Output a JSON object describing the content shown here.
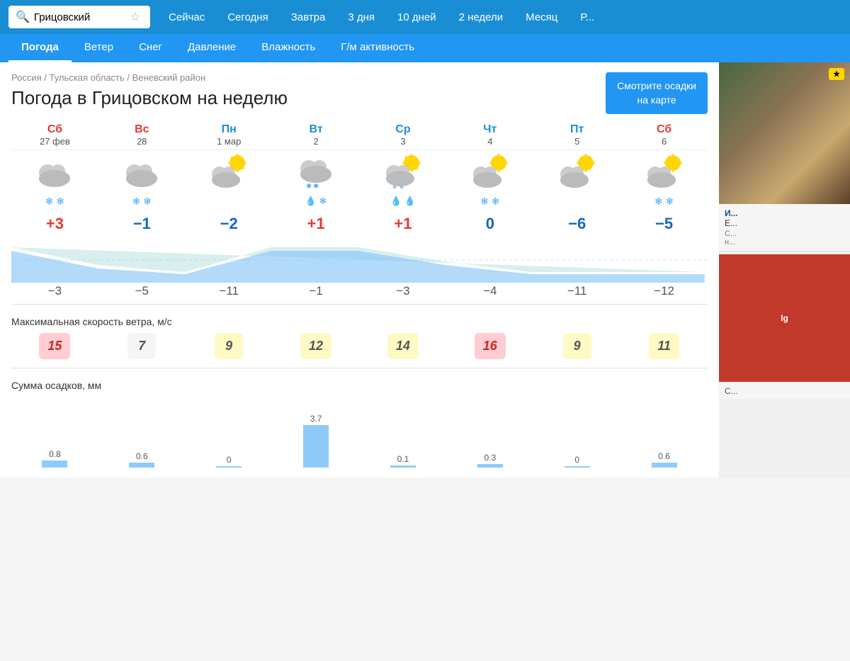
{
  "topNav": {
    "searchPlaceholder": "Грицовский",
    "starLabel": "☆",
    "links": [
      "Сейчас",
      "Сегодня",
      "Завтра",
      "3 дня",
      "10 дней",
      "2 недели",
      "Месяц",
      "Р..."
    ]
  },
  "secondNav": {
    "links": [
      "Погода",
      "Ветер",
      "Снег",
      "Давление",
      "Влажность",
      "Г/м активность"
    ],
    "active": "Погода"
  },
  "breadcrumb": {
    "parts": [
      "Россия",
      "Тульская область",
      "Веневский район"
    ]
  },
  "pageTitle": "Погода в Грицовском на неделю",
  "mapButton": "Смотрите осадки\nна карте",
  "days": [
    {
      "name": "Сб",
      "date": "27 фев",
      "type": "weekend",
      "icon": "cloudy",
      "precip": "snow2",
      "hiTemp": "+3",
      "loTemp": "−3",
      "wind": 15,
      "windClass": "high",
      "precipMm": 0.8
    },
    {
      "name": "Вс",
      "date": "28",
      "type": "weekend",
      "icon": "cloudy",
      "precip": "snow2",
      "hiTemp": "−1",
      "loTemp": "−5",
      "wind": 7,
      "windClass": "low",
      "precipMm": 0.6
    },
    {
      "name": "Пн",
      "date": "1 мар",
      "type": "weekday",
      "icon": "sunny-cloudy",
      "precip": "none",
      "hiTemp": "−2",
      "loTemp": "−11",
      "wind": 9,
      "windClass": "med",
      "precipMm": 0
    },
    {
      "name": "Вт",
      "date": "2",
      "type": "weekday",
      "icon": "cloudy-rain-snow",
      "precip": "rain-snow",
      "hiTemp": "+1",
      "loTemp": "−1",
      "wind": 12,
      "windClass": "med",
      "precipMm": 3.7
    },
    {
      "name": "Ср",
      "date": "3",
      "type": "weekday",
      "icon": "sunny-cloudy",
      "precip": "rain",
      "hiTemp": "+1",
      "loTemp": "−3",
      "wind": 14,
      "windClass": "med",
      "precipMm": 0.1
    },
    {
      "name": "Чт",
      "date": "4",
      "type": "weekday",
      "icon": "sunny-cloudy",
      "precip": "snow2",
      "hiTemp": "0",
      "loTemp": "−4",
      "wind": 16,
      "windClass": "high",
      "precipMm": 0.3
    },
    {
      "name": "Пт",
      "date": "5",
      "type": "weekday",
      "icon": "sunny-cloudy",
      "precip": "none",
      "hiTemp": "−6",
      "loTemp": "−11",
      "wind": 9,
      "windClass": "med",
      "precipMm": 0
    },
    {
      "name": "Сб",
      "date": "6",
      "type": "weekend",
      "icon": "sunny-cloudy",
      "precip": "snow2",
      "hiTemp": "−5",
      "loTemp": "−12",
      "wind": 11,
      "windClass": "med",
      "precipMm": 0.6
    }
  ],
  "sections": {
    "windLabel": "Максимальная скорость ветра, м/с",
    "precipLabel": "Сумма осадков, мм"
  }
}
